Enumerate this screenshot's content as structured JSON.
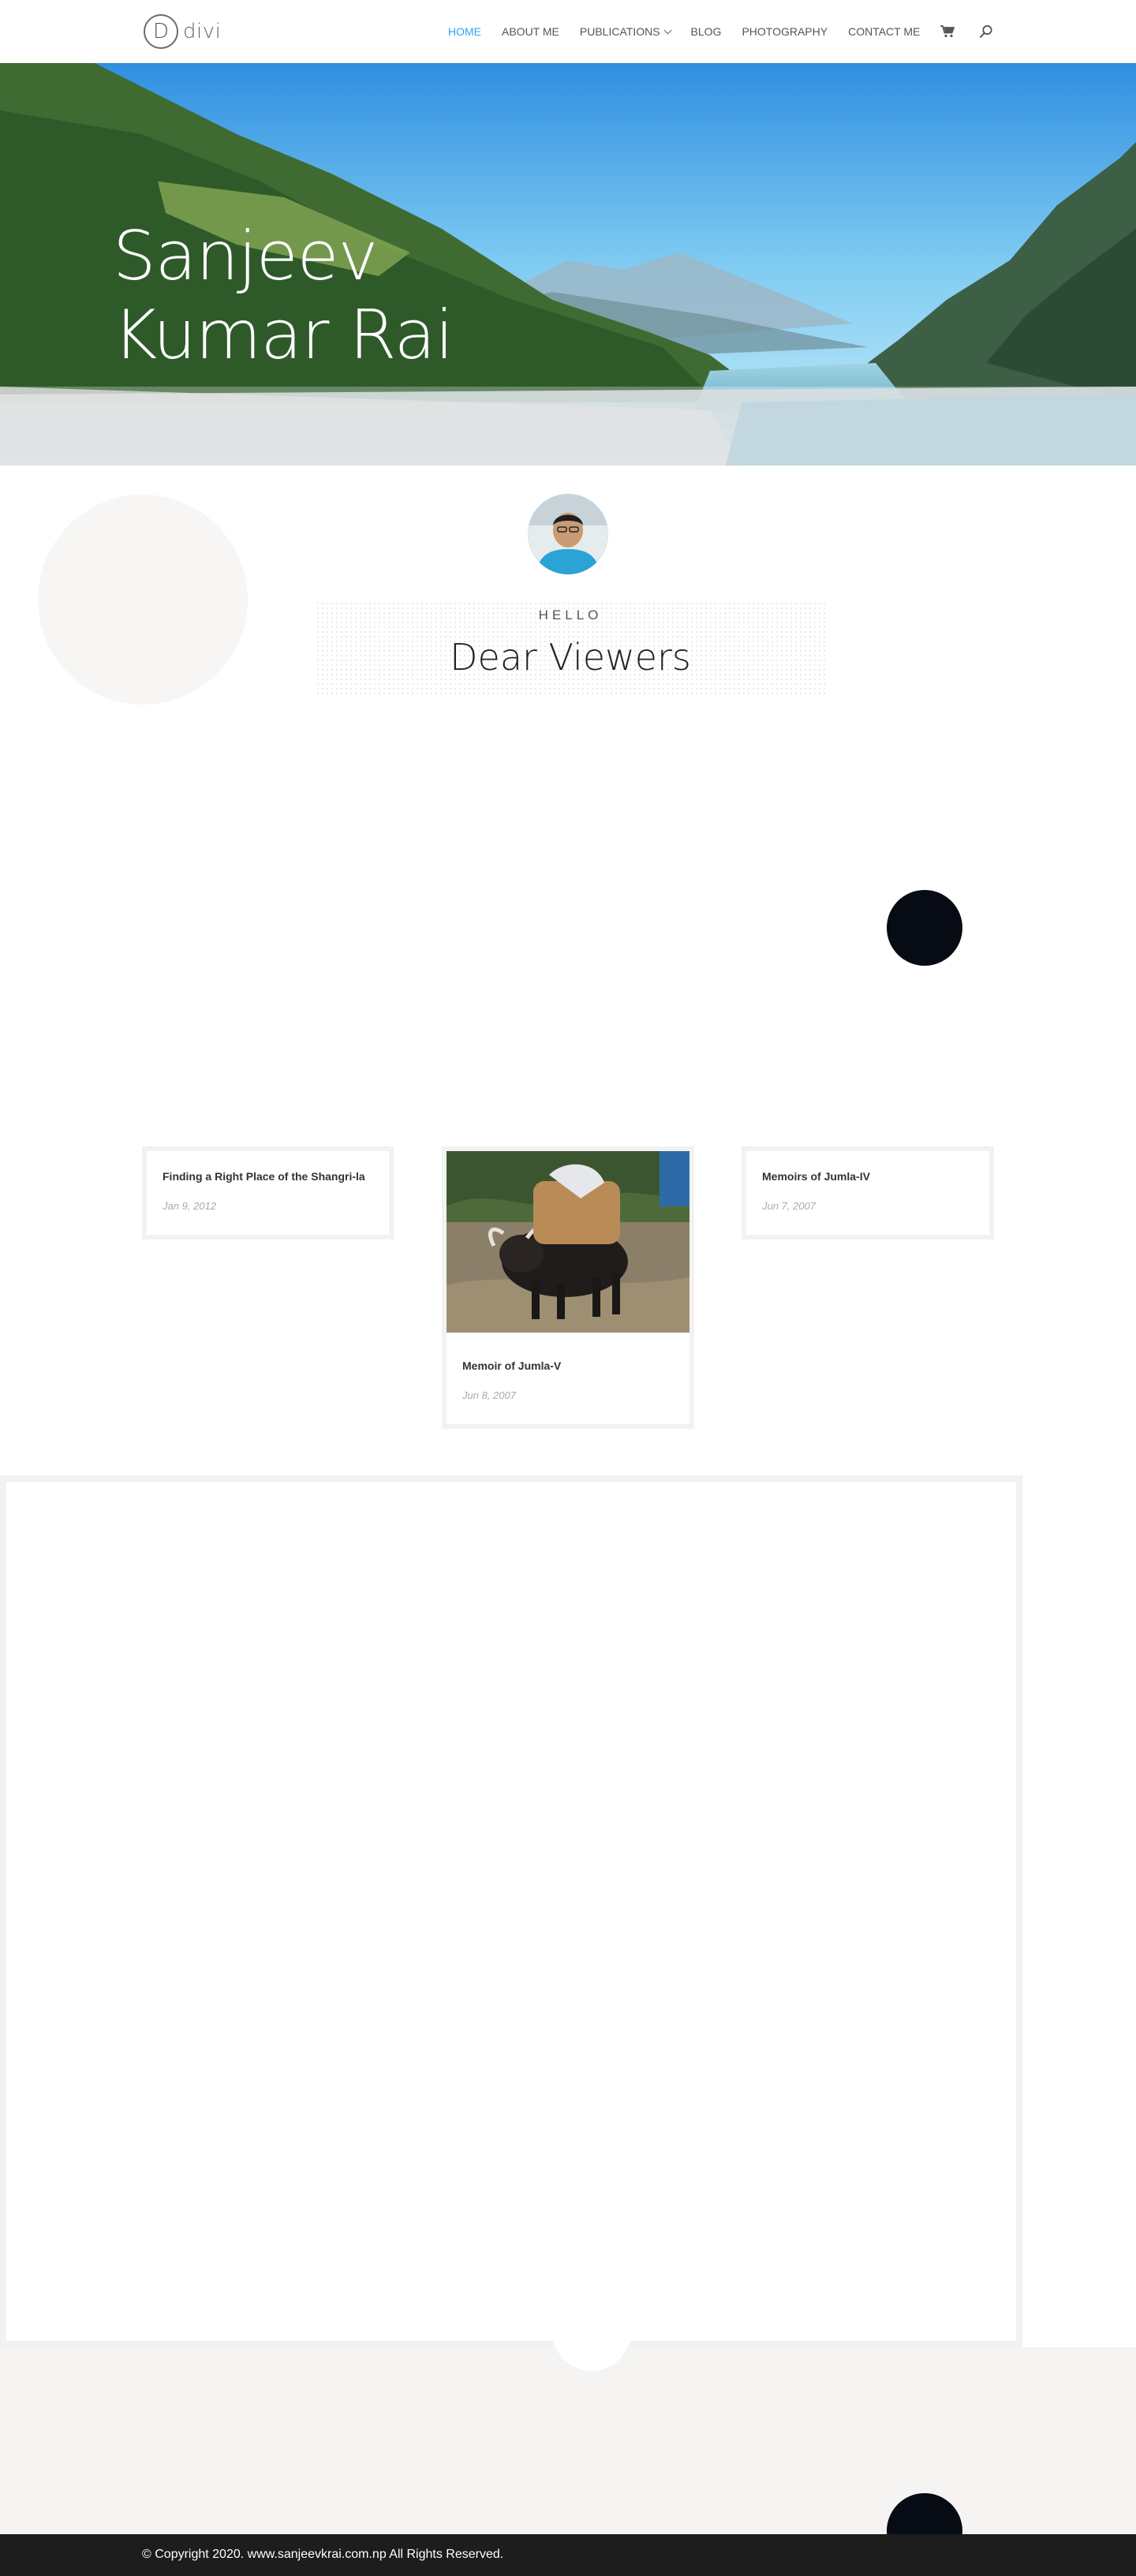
{
  "header": {
    "logo_letter": "D",
    "logo_text": "divi",
    "nav": [
      {
        "label": "HOME",
        "active": true
      },
      {
        "label": "ABOUT ME",
        "active": false
      },
      {
        "label": "PUBLICATIONS",
        "active": false,
        "has_dropdown": true
      },
      {
        "label": "BLOG",
        "active": false
      },
      {
        "label": "PHOTOGRAPHY",
        "active": false
      },
      {
        "label": "CONTACT ME",
        "active": false
      }
    ],
    "icons": [
      "cart-icon",
      "search-icon"
    ],
    "active_color": "#2ea3f2"
  },
  "hero": {
    "title_line1": "Sanjeev",
    "title_line2": "Kumar Rai"
  },
  "intro": {
    "eyebrow": "HELLO",
    "heading": "Dear Viewers"
  },
  "posts": [
    {
      "title": "Finding a Right Place of the Shangri-la",
      "date": "Jan 9, 2012",
      "has_image": false
    },
    {
      "title": "Memoir of Jumla-V",
      "date": "Jun 8, 2007",
      "has_image": true
    },
    {
      "title": "Memoirs of Jumla-IV",
      "date": "Jun 7, 2007",
      "has_image": false
    }
  ],
  "footer": {
    "copyright": "© Copyright 2020. www.sanjeevkrai.com.np All Rights Reserved."
  },
  "colors": {
    "footer_bg": "#1d1d1d",
    "dark_accent": "#070b14",
    "light_grey": "#f5f4f2"
  }
}
